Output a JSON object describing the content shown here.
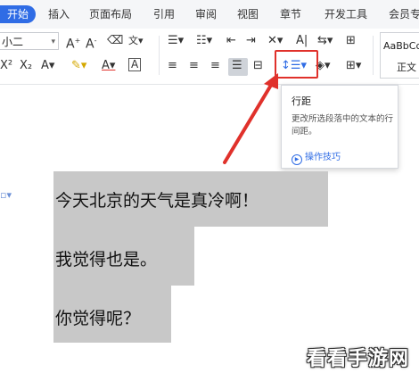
{
  "menu": {
    "tabs": [
      "开始",
      "插入",
      "页面布局",
      "引用",
      "审阅",
      "视图",
      "章节",
      "开发工具",
      "会员专"
    ]
  },
  "toolbar": {
    "font_size": "小二",
    "styles": [
      "AaBbCc",
      "正文"
    ]
  },
  "tooltip": {
    "title": "行距",
    "description": "更改所选段落中的文本的行间距。",
    "link": "操作技巧"
  },
  "document": {
    "lines": [
      "今天北京的天气是真冷啊！",
      "我觉得也是。",
      "你觉得呢？"
    ]
  },
  "watermark": "看看手游网",
  "colors": {
    "accent": "#2f6ce5",
    "highlight": "#e0312b",
    "selection": "#c8c8c8"
  }
}
